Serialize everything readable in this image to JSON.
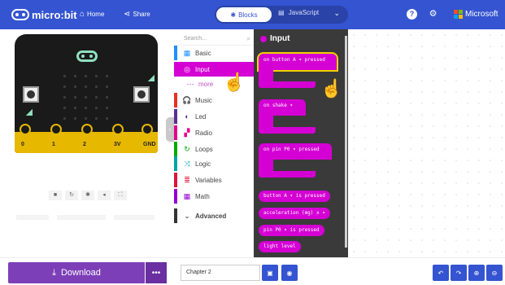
{
  "header": {
    "brand": "micro:bit",
    "nav_home": "Home",
    "nav_share": "Share",
    "tab_blocks": "Blocks",
    "tab_javascript": "JavaScript",
    "ms_label": "Microsoft",
    "icons": [
      "home-icon",
      "share-icon",
      "help-icon",
      "gear-icon"
    ],
    "ms_colors": [
      "#f25022",
      "#7fba00",
      "#00a4ef",
      "#ffb900"
    ]
  },
  "simulator": {
    "pins": [
      "0",
      "1",
      "2",
      "3V",
      "GND"
    ],
    "controls": [
      "stop-icon",
      "restart-icon",
      "slowmo-icon",
      "sound-icon",
      "fullscreen-icon"
    ],
    "control_glyphs": [
      "■",
      "↻",
      "✱",
      "◂",
      "⛶"
    ]
  },
  "toolbox": {
    "search_placeholder": "Search...",
    "categories": [
      {
        "label": "Basic",
        "color": "#1e90ff",
        "icon": "grid-icon"
      },
      {
        "label": "Input",
        "color": "#d400d4",
        "icon": "target-icon",
        "selected": true
      },
      {
        "label": "more",
        "color": "#d400d4",
        "icon": "dots-icon"
      },
      {
        "label": "Music",
        "color": "#e63022",
        "icon": "headphones-icon"
      },
      {
        "label": "Led",
        "color": "#5c2d91",
        "icon": "toggle-icon"
      },
      {
        "label": "Radio",
        "color": "#e3008c",
        "icon": "signal-icon"
      },
      {
        "label": "Loops",
        "color": "#00aa00",
        "icon": "loop-icon"
      },
      {
        "label": "Logic",
        "color": "#00a4a6",
        "icon": "shuffle-icon"
      },
      {
        "label": "Variables",
        "color": "#dc143c",
        "icon": "list-icon"
      },
      {
        "label": "Math",
        "color": "#9400d3",
        "icon": "calculator-icon"
      },
      {
        "label": "Advanced",
        "color": "#333333",
        "icon": "chevron-down-icon"
      }
    ]
  },
  "flyout": {
    "title": "Input",
    "blocks": [
      "on button  A ▾  pressed",
      "on  shake ▾",
      "on pin  P0 ▾  pressed",
      "button  A ▾  is pressed",
      "acceleration (mg)  x ▾",
      "pin  P0 ▾  is pressed",
      "light level"
    ]
  },
  "bottom": {
    "download_label": "Download",
    "more_label": "•••",
    "project_name": "Chapter 2"
  },
  "colors": {
    "topbar": "#3454d1",
    "input_block": "#d400d4",
    "download": "#7d3fb8"
  }
}
